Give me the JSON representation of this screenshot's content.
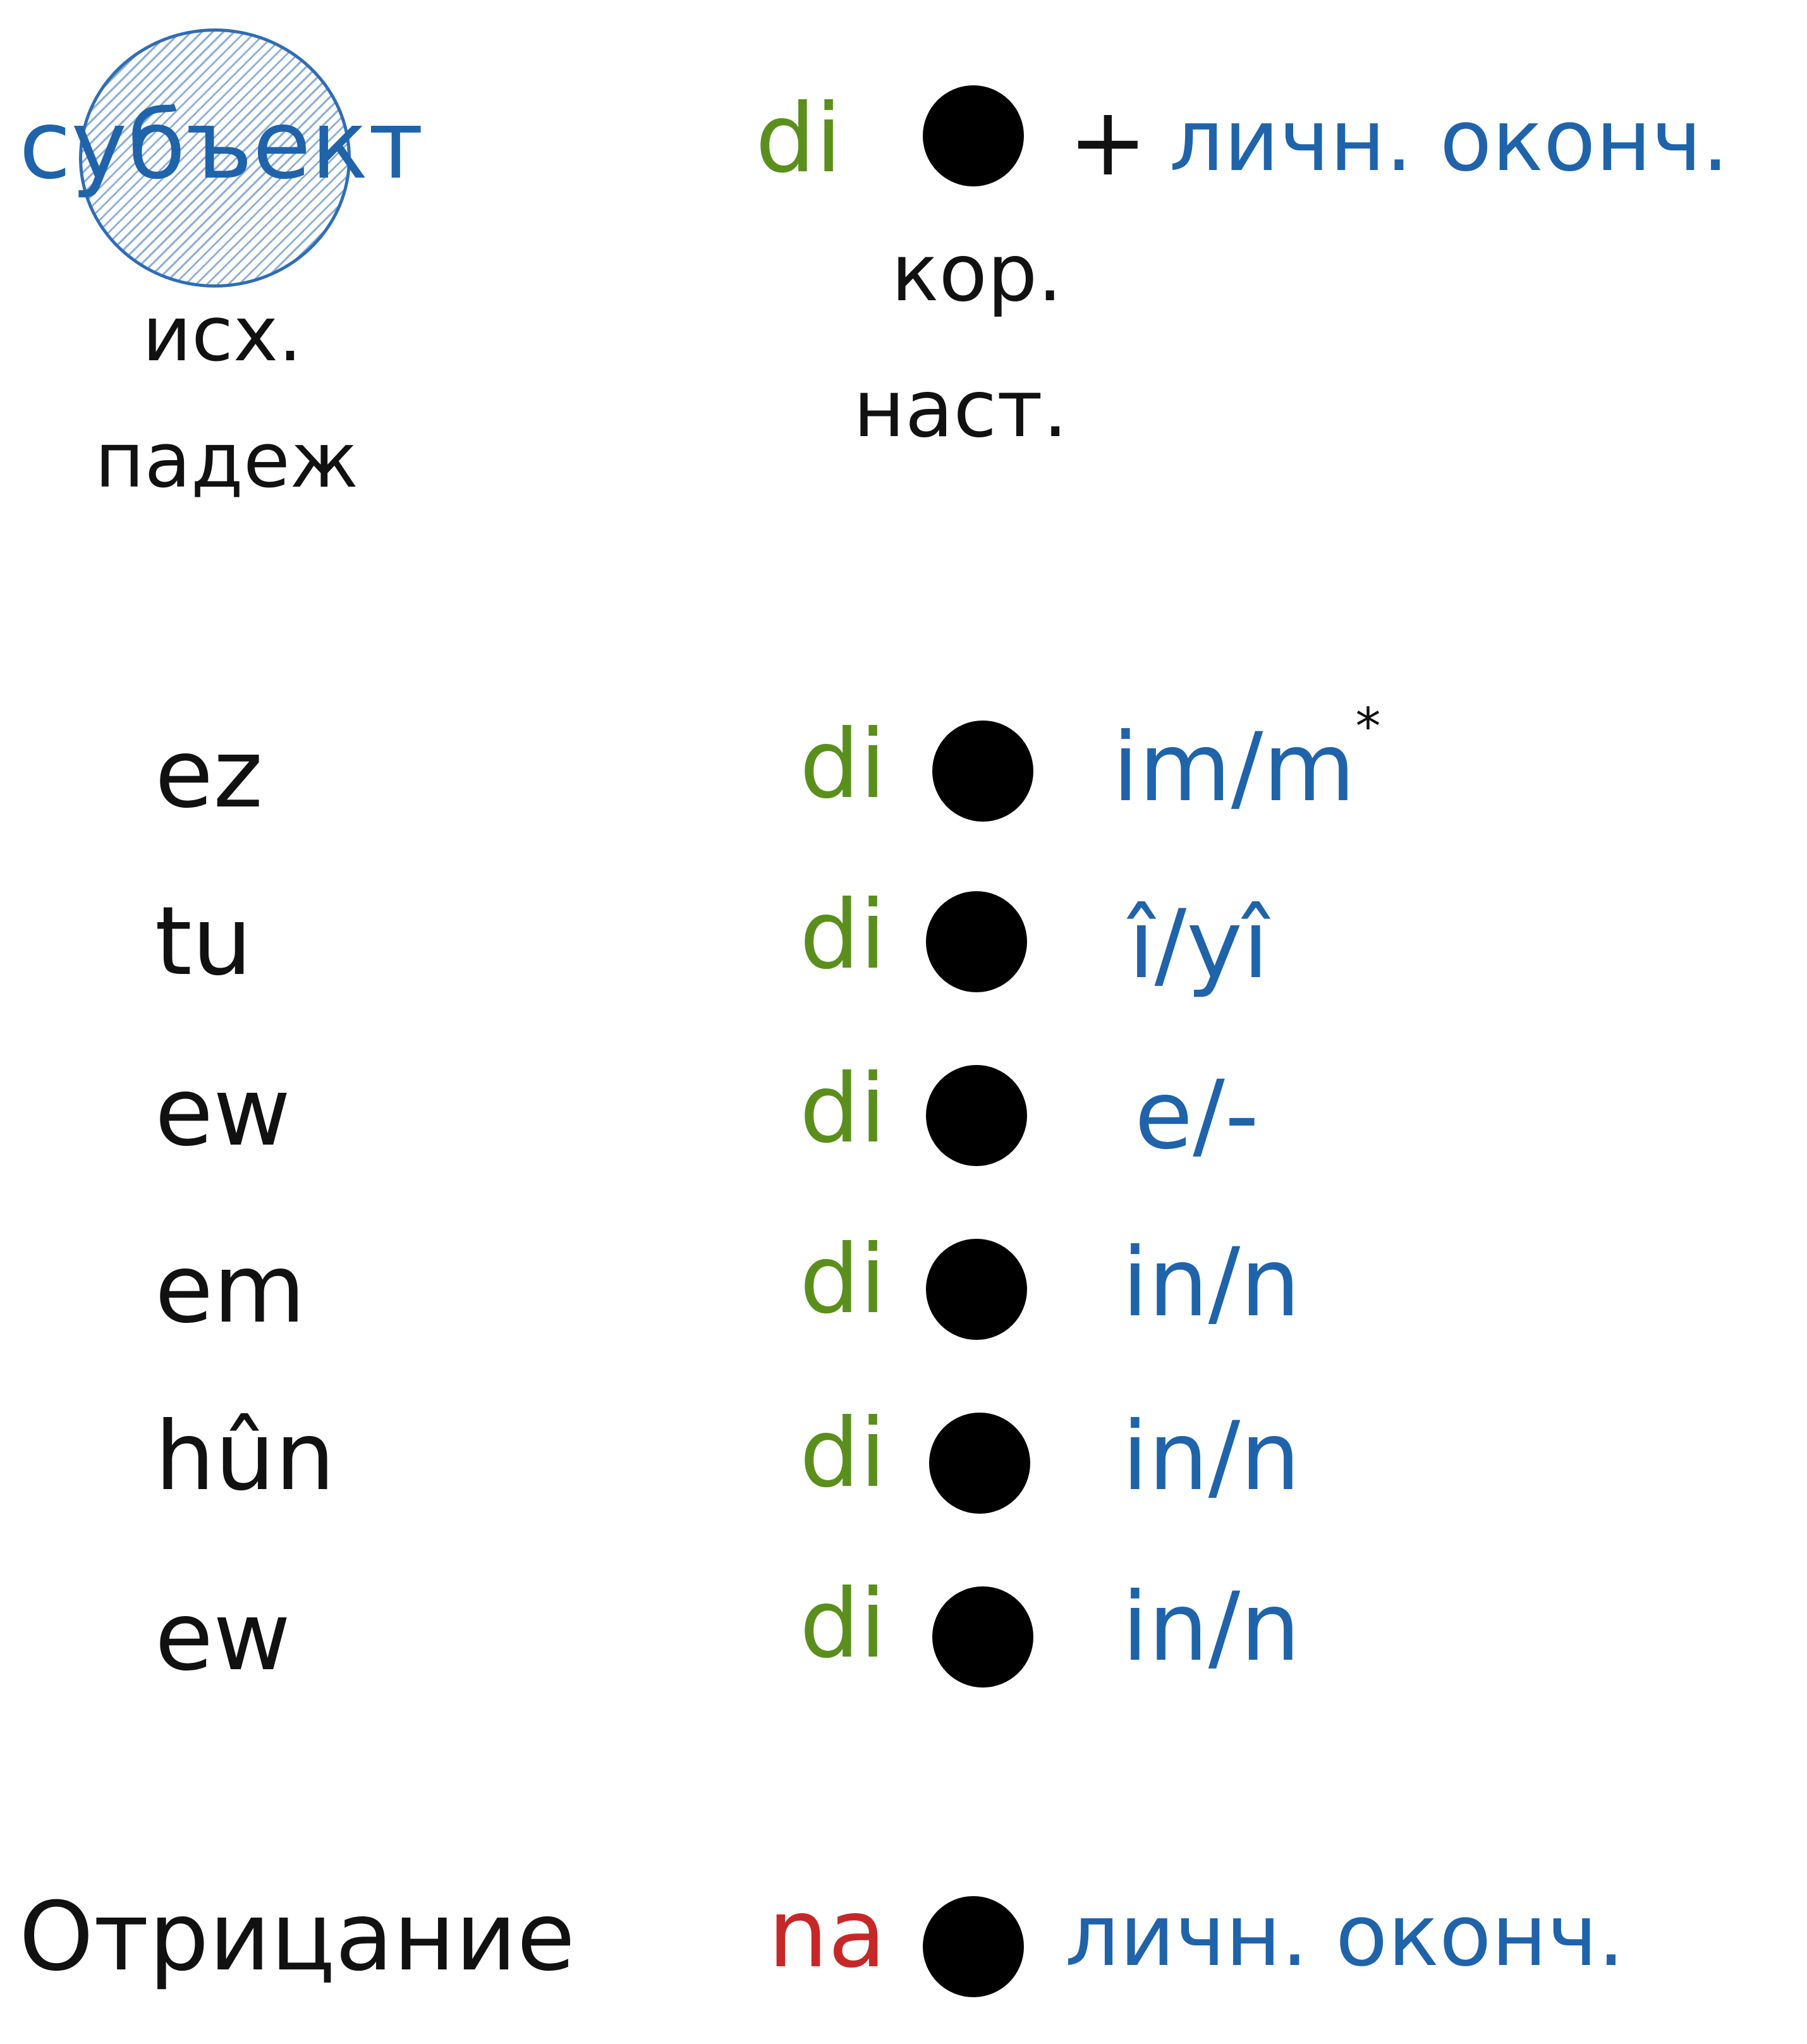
{
  "header": {
    "subject": "субъект",
    "case_line1": "исх.",
    "case_line2": "падеж",
    "verb": "di",
    "plus": "+",
    "ending": "личн. оконч.",
    "root_label": "кор.",
    "tense_label": "наст."
  },
  "rows": [
    {
      "pronoun": "ez",
      "verb": "di",
      "ending": "im/m",
      "note": "*"
    },
    {
      "pronoun": "tu",
      "verb": "di",
      "ending": "î/yî",
      "note": ""
    },
    {
      "pronoun": "ew",
      "verb": "di",
      "ending": "e/-",
      "note": ""
    },
    {
      "pronoun": "em",
      "verb": "di",
      "ending": "in/n",
      "note": ""
    },
    {
      "pronoun": "hûn",
      "verb": "di",
      "ending": "in/n",
      "note": ""
    },
    {
      "pronoun": "ew",
      "verb": "di",
      "ending": "in/n",
      "note": ""
    }
  ],
  "negation": {
    "label": "Отрицание",
    "particle": "na",
    "ending": "личн. оконч."
  },
  "colors": {
    "verb": "#5a8f1c",
    "ending": "#1f63aa",
    "negation": "#c62828",
    "text": "#111111",
    "root_dot": "#000000"
  }
}
